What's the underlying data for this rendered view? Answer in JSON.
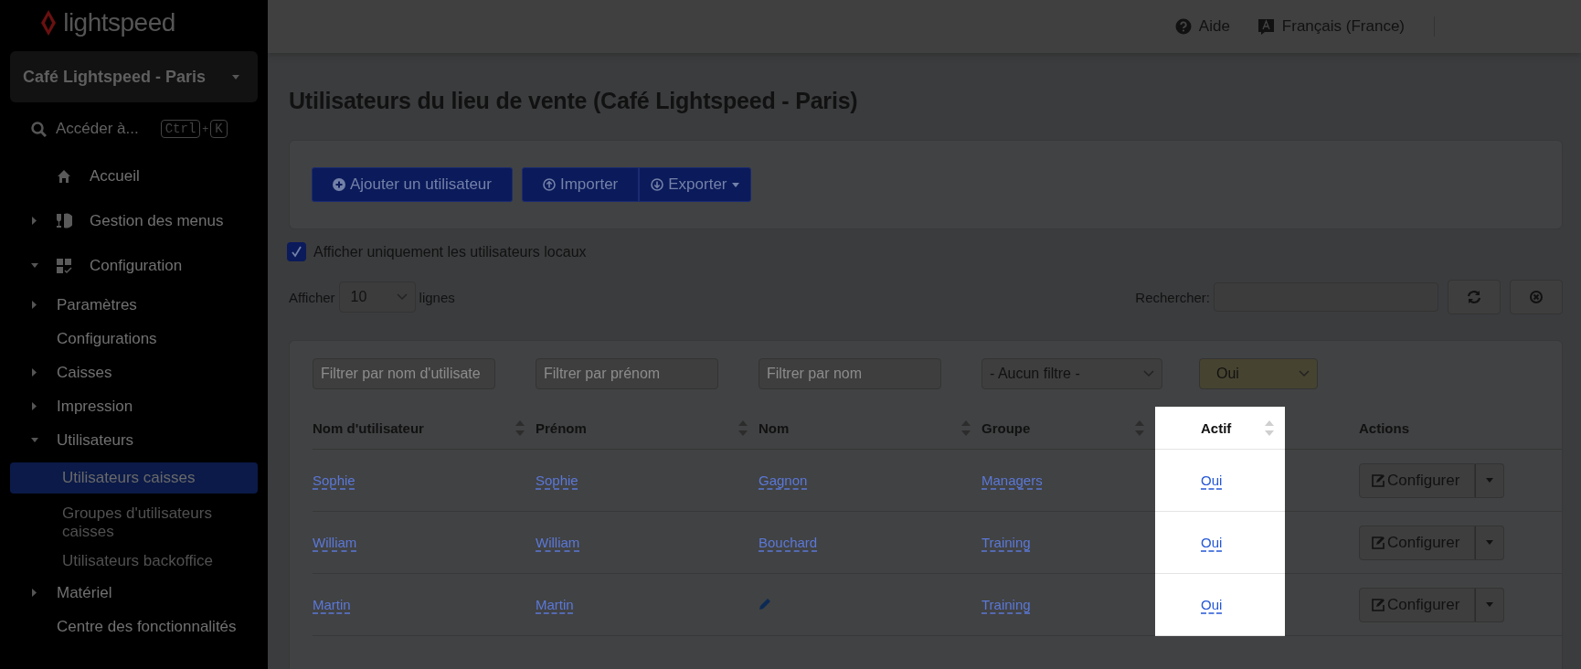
{
  "header": {
    "help": "Aide",
    "language": "Français (France)"
  },
  "sidebar": {
    "logo": "lightspeed",
    "store": "Café Lightspeed - Paris",
    "quick_access": {
      "label": "Accéder à...",
      "keys": [
        "Ctrl",
        "+",
        "K"
      ]
    },
    "items": [
      {
        "kind": "link",
        "label": "Accueil"
      },
      {
        "kind": "group",
        "label": "Gestion des menus",
        "expanded": false
      },
      {
        "kind": "group",
        "label": "Configuration",
        "expanded": true,
        "children": [
          {
            "kind": "group",
            "label": "Paramètres",
            "expanded": false
          },
          {
            "kind": "link",
            "label": "Configurations"
          },
          {
            "kind": "group",
            "label": "Caisses",
            "expanded": false
          },
          {
            "kind": "group",
            "label": "Impression",
            "expanded": false
          },
          {
            "kind": "group",
            "label": "Utilisateurs",
            "expanded": true,
            "children": [
              {
                "kind": "leaf",
                "label": "Utilisateurs caisses",
                "selected": true
              },
              {
                "kind": "leaf",
                "label": "Groupes d'utilisateurs caisses",
                "selected": false
              },
              {
                "kind": "leaf",
                "label": "Utilisateurs backoffice",
                "selected": false
              }
            ]
          },
          {
            "kind": "group",
            "label": "Matériel",
            "expanded": false
          },
          {
            "kind": "link",
            "label": "Centre des fonctionnalités"
          }
        ]
      }
    ]
  },
  "page": {
    "title": "Utilisateurs du lieu de vente (Café Lightspeed - Paris)",
    "toolbar": [
      {
        "kind": "add",
        "label": "Ajouter un utilisateur"
      },
      {
        "kind": "import",
        "label": "Importer"
      },
      {
        "kind": "export",
        "label": "Exporter"
      }
    ],
    "local_only": {
      "label": "Afficher uniquement les utilisateurs locaux",
      "checked": true
    },
    "length": {
      "prefix": "Afficher",
      "value": "10",
      "suffix": "lignes"
    },
    "search": {
      "label": "Rechercher:"
    }
  },
  "table": {
    "filters": [
      {
        "kind": "text",
        "placeholder": "Filtrer par nom d'utilisate",
        "active": false
      },
      {
        "kind": "text",
        "placeholder": "Filtrer par prénom",
        "active": false
      },
      {
        "kind": "text",
        "placeholder": "Filtrer par nom",
        "active": false
      },
      {
        "kind": "select",
        "value": "- Aucun filtre -",
        "active": false
      },
      {
        "kind": "select",
        "value": "Oui",
        "active": true
      }
    ],
    "columns": [
      {
        "label": "Nom d'utilisateur",
        "sortable": true,
        "highlighted": false
      },
      {
        "label": "Prénom",
        "sortable": true,
        "highlighted": false
      },
      {
        "label": "Nom",
        "sortable": true,
        "highlighted": false
      },
      {
        "label": "Groupe",
        "sortable": true,
        "highlighted": false
      },
      {
        "label": "Actif",
        "sortable": true,
        "highlighted": true
      },
      {
        "label": "Actions",
        "sortable": false,
        "highlighted": false
      }
    ],
    "rows": [
      {
        "username": "Sophie",
        "first_name": "Sophie",
        "last_name": "Gagnon",
        "group": "Managers",
        "active": "Oui",
        "action": "Configurer"
      },
      {
        "username": "William",
        "first_name": "William",
        "last_name": "Bouchard",
        "group": "Training",
        "active": "Oui",
        "action": "Configurer"
      },
      {
        "username": "Martin",
        "first_name": "Martin",
        "group": "Training",
        "active": "Oui",
        "action": "Configurer"
      }
    ]
  }
}
